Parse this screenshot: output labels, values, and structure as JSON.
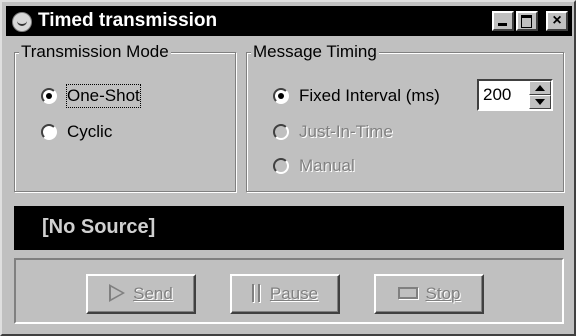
{
  "window": {
    "title": "Timed transmission",
    "icon": "app-icon",
    "controls": {
      "minimize": "minimize-icon",
      "maximize": "maximize-icon",
      "close_label": "×"
    }
  },
  "transmission_mode": {
    "legend": "Transmission Mode",
    "options": [
      {
        "label": "One-Shot",
        "selected": true,
        "enabled": true,
        "focused": true
      },
      {
        "label": "Cyclic",
        "selected": false,
        "enabled": true,
        "focused": false
      }
    ]
  },
  "message_timing": {
    "legend": "Message Timing",
    "options": [
      {
        "label": "Fixed Interval (ms)",
        "selected": true,
        "enabled": true
      },
      {
        "label": "Just-In-Time",
        "selected": false,
        "enabled": false
      },
      {
        "label": "Manual",
        "selected": false,
        "enabled": false
      }
    ],
    "interval_value": "200"
  },
  "source": {
    "text": "[No Source]"
  },
  "buttons": {
    "send": {
      "label": "Send",
      "icon": "play-icon",
      "enabled": false
    },
    "pause": {
      "label": "Pause",
      "icon": "pause-icon",
      "enabled": false
    },
    "stop": {
      "label": "Stop",
      "icon": "stop-icon",
      "enabled": false
    }
  },
  "colors": {
    "face": "#c0c0c0",
    "titlebar": "#000000",
    "source_bg": "#000000",
    "disabled_text": "#808080"
  }
}
